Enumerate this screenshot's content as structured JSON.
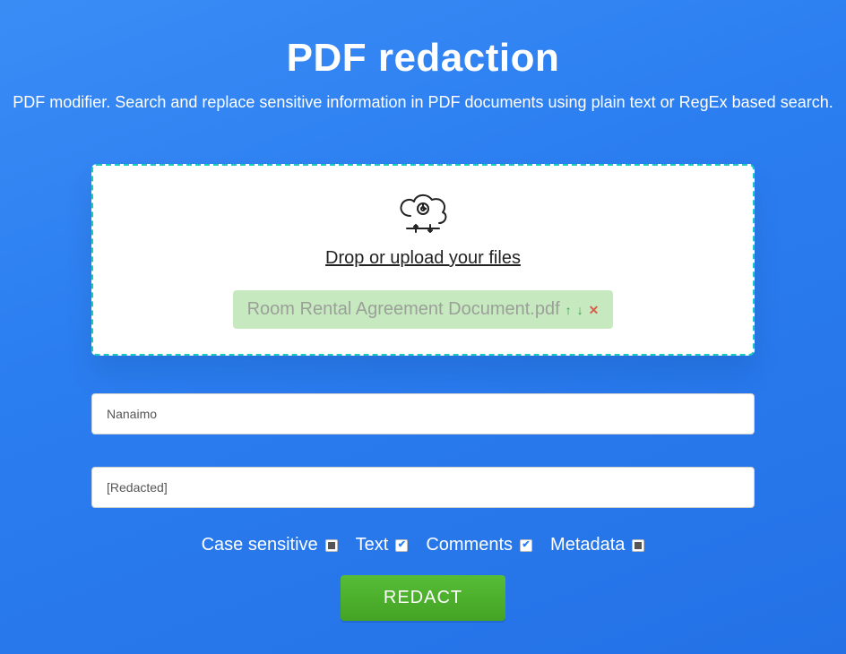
{
  "header": {
    "title": "PDF redaction",
    "subtitle": "PDF modifier. Search and replace sensitive information in PDF documents using plain text or RegEx based search."
  },
  "dropzone": {
    "label": "Drop or upload your files",
    "file": {
      "name": "Room Rental Agreement Document.pdf"
    }
  },
  "inputs": {
    "search_value": "Nanaimo",
    "replace_value": "[Redacted]"
  },
  "options": {
    "case_sensitive": {
      "label": "Case sensitive",
      "state": "indeterminate"
    },
    "text": {
      "label": "Text",
      "state": "checked"
    },
    "comments": {
      "label": "Comments",
      "state": "checked"
    },
    "metadata": {
      "label": "Metadata",
      "state": "indeterminate"
    }
  },
  "action": {
    "redact_label": "REDACT"
  }
}
